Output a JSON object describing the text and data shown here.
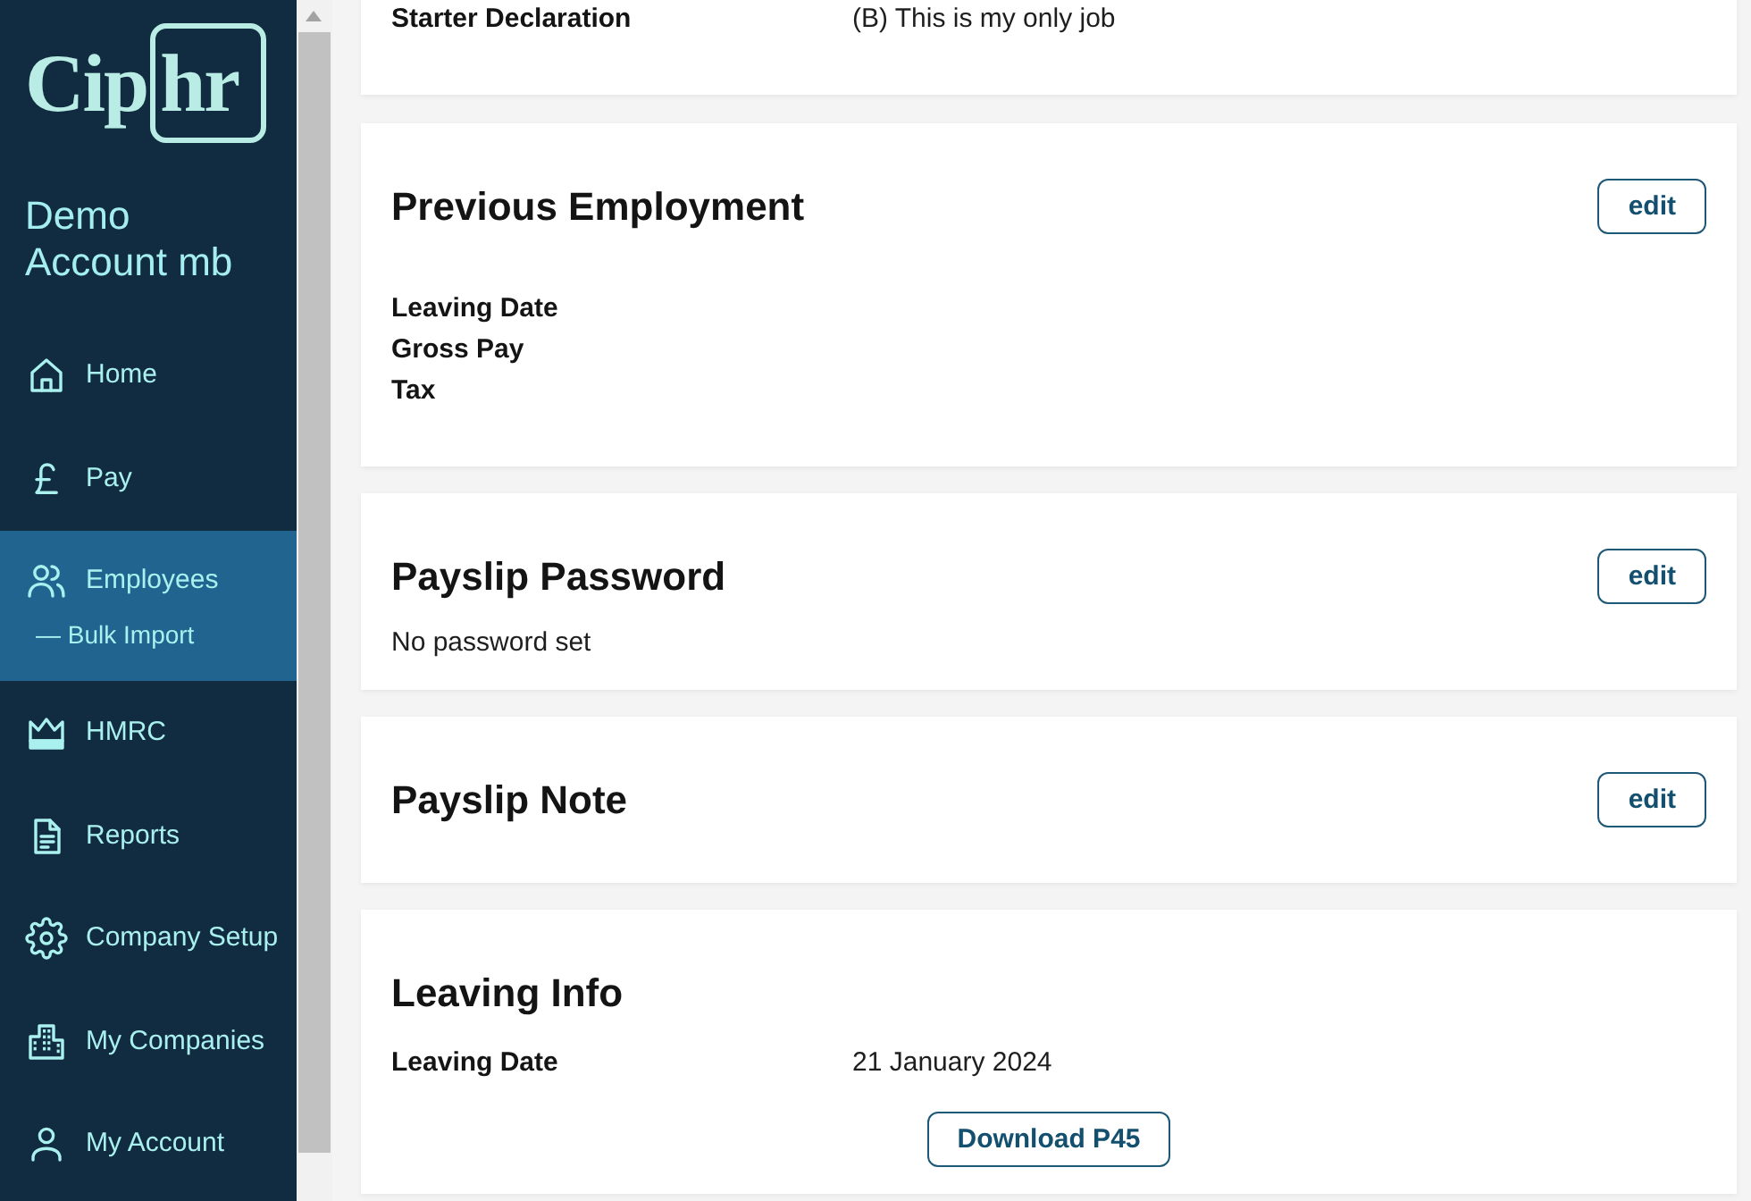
{
  "sidebar": {
    "logo": "Ciphr",
    "account_name": "Demo Account mb",
    "items": [
      {
        "label": "Home",
        "selected": false
      },
      {
        "label": "Pay",
        "selected": false
      },
      {
        "label": "Employees",
        "selected": true,
        "children": [
          {
            "label": "— Bulk Import",
            "selected": false
          }
        ]
      },
      {
        "label": "HMRC",
        "selected": false
      },
      {
        "label": "Reports",
        "selected": false
      },
      {
        "label": "Company Setup",
        "selected": false
      },
      {
        "label": "My Companies",
        "selected": false
      },
      {
        "label": "My Account",
        "selected": false
      }
    ]
  },
  "cards": [
    {
      "rows": [
        {
          "label": "Starter Declaration",
          "value": "(B) This is my only job"
        }
      ]
    },
    {
      "title": "Previous Employment",
      "button": "edit",
      "rows": [
        {
          "label": "Leaving Date"
        },
        {
          "label": "Gross Pay"
        },
        {
          "label": "Tax"
        }
      ]
    },
    {
      "title": "Payslip Password",
      "button": "edit",
      "note": "No password set"
    },
    {
      "title": "Payslip Note",
      "button": "edit"
    },
    {
      "title": "Leaving Info",
      "rows": [
        {
          "label": "Leaving Date",
          "value": "21 January 2024"
        }
      ],
      "action": "Download P45"
    }
  ]
}
